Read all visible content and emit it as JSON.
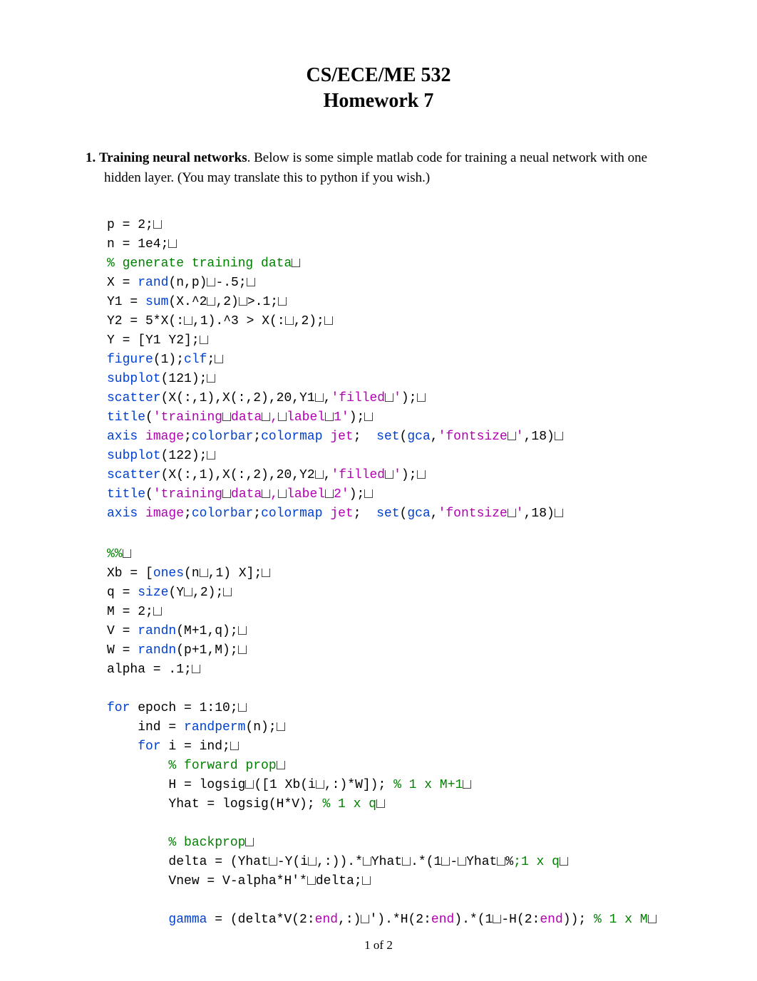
{
  "title": "CS/ECE/ME 532",
  "subtitle": "Homework 7",
  "problem": {
    "number": "1.",
    "topic": "Training neural networks",
    "text": ". Below is some simple matlab code for training a neual network with one hidden layer. (You may translate this to python if you wish.)"
  },
  "code1": {
    "l1a": "p = 2;",
    "l2a": "n = 1e4;",
    "l3a": "% generate training data",
    "l4a": "X = ",
    "l4b": "rand",
    "l4c": "(n,p)",
    "l4d": "-.5;",
    "l5a": "Y1 = ",
    "l5b": "sum",
    "l5c": "(X.^2",
    "l5d": ",2)",
    "l5e": ">.1;",
    "l6a": "Y2 = 5*X(:",
    "l6b": ",1).^3 > X(:",
    "l6c": ",2);",
    "l7a": "Y = [Y1 Y2];",
    "l8a": "figure",
    "l8b": "(1);",
    "l8c": "clf",
    "l8d": ";",
    "l9a": "subplot",
    "l9b": "(121);",
    "l10a": "scatter",
    "l10b": "(X(:,1),X(:,2),20,Y1",
    "l10c": ",",
    "l10d": "'filled",
    "l10e": "'",
    "l10f": ");",
    "l11a": "title",
    "l11b": "(",
    "l11c": "'training",
    "l11d": "data",
    "l11e": ",",
    "l11f": "label",
    "l11g": "1'",
    "l11h": ");",
    "l12a": "axis",
    "l12b": " ",
    "l12c": "image",
    "l12d": ";",
    "l12e": "colorbar",
    "l12f": ";",
    "l12g": "colormap",
    "l12h": " ",
    "l12i": "jet",
    "l12j": ";  ",
    "l12k": "set",
    "l12l": "(",
    "l12m": "gca",
    "l12n": ",",
    "l12o": "'fontsize",
    "l12p": "'",
    "l12q": ",18)",
    "l13a": "subplot",
    "l13b": "(122);",
    "l14a": "scatter",
    "l14b": "(X(:,1),X(:,2),20,Y2",
    "l14c": ",",
    "l14d": "'filled",
    "l14e": "'",
    "l14f": ");",
    "l15a": "title",
    "l15b": "(",
    "l15c": "'training",
    "l15d": "data",
    "l15e": ",",
    "l15f": "label",
    "l15g": "2'",
    "l15h": ");",
    "l16a": "axis",
    "l16b": " ",
    "l16c": "image",
    "l16d": ";",
    "l16e": "colorbar",
    "l16f": ";",
    "l16g": "colormap",
    "l16h": " ",
    "l16i": "jet",
    "l16j": ";  ",
    "l16k": "set",
    "l16l": "(",
    "l16m": "gca",
    "l16n": ",",
    "l16o": "'fontsize",
    "l16p": "'",
    "l16q": ",18)"
  },
  "code2": {
    "l1a": "%%",
    "l2a": "Xb = [",
    "l2b": "ones",
    "l2c": "(n",
    "l2d": ",1) X];",
    "l3a": "q = ",
    "l3b": "size",
    "l3c": "(Y",
    "l3d": ",2);",
    "l4a": "M = 2;",
    "l5a": "V = ",
    "l5b": "randn",
    "l5c": "(M+1,q);",
    "l6a": "W = ",
    "l6b": "randn",
    "l6c": "(p+1,M);",
    "l7a": "alpha = .1;",
    "l8a": "for",
    "l8b": " epoch = 1:10;",
    "l9a": "    ind = ",
    "l9b": "randperm",
    "l9c": "(n);",
    "l10a": "    ",
    "l10b": "for",
    "l10c": " i = ind;",
    "l11a": "        ",
    "l11b": "% forward prop",
    "l12a": "        H = logsig",
    "l12b": "([1 Xb(i",
    "l12c": ",:)*W]); ",
    "l12d": "% 1 x M+1",
    "l13a": "        Yhat = logsig(H*V); ",
    "l13b": "% 1 x q",
    "l14a": "        ",
    "l14b": "% backprop",
    "l15a": "        delta = (Yhat",
    "l15b": "-Y(i",
    "l15c": ",:)).*",
    "l15d": "Yhat",
    "l15e": ".*(1",
    "l15f": "-",
    "l15g": "Yhat",
    "l15h": "%",
    "l15i": ";1 x q",
    "l16a": "        Vnew = V-alpha*H'*",
    "l16b": "delta;",
    "l17a": "        ",
    "l17b": "gamma",
    "l17c": " = (delta*V(2:",
    "l17d": "end",
    "l17e": ",:)",
    "l17f": "'",
    "l17g": ").*H(2:",
    "l17h": "end",
    "l17i": ").*(1",
    "l17j": "-H(2:",
    "l17k": "end",
    "l17l": ")); ",
    "l17m": "% 1 x M"
  },
  "footer": "1 of 2"
}
